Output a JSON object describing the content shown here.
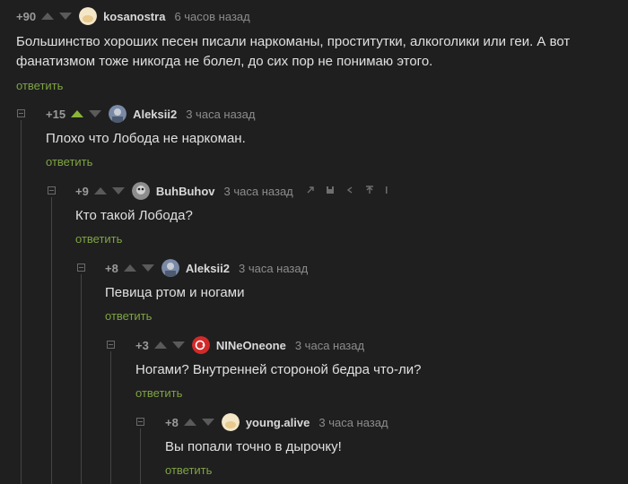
{
  "comments": [
    {
      "rating": "+90",
      "author": "kosanostra",
      "time": "6 часов назад",
      "text": "Большинство хороших песен писали наркоманы, проститутки, алкоголики или геи.  А вот фанатизмом тоже никогда не болел, до сих пор не понимаю этого.",
      "reply": "ответить",
      "avatar_color": "#f3e7c8"
    },
    {
      "rating": "+15",
      "author": "Aleksii2",
      "time": "3 часа назад",
      "text": "Плохо что Лобода не наркоман.",
      "reply": "ответить",
      "avatar_color": "#7a8aa6"
    },
    {
      "rating": "+9",
      "author": "BuhBuhov",
      "time": "3 часа назад",
      "text": "Кто такой Лобода?",
      "reply": "ответить",
      "avatar_color": "#8d8d8d"
    },
    {
      "rating": "+8",
      "author": "Aleksii2",
      "time": "3 часа назад",
      "text": "Певица ртом и ногами",
      "reply": "ответить",
      "avatar_color": "#7a8aa6"
    },
    {
      "rating": "+3",
      "author": "NINeOneone",
      "time": "3 часа назад",
      "text": "Ногами? Внутренней стороной бедра что-ли?",
      "reply": "ответить",
      "avatar_color": "#d22a2a"
    },
    {
      "rating": "+8",
      "author": "young.alive",
      "time": "3 часа назад",
      "text": "Вы попали точно в дырочку!",
      "reply": "ответить",
      "avatar_color": "#f3e7c8"
    }
  ],
  "icons": [
    "link-icon",
    "save-icon",
    "share-icon",
    "upload-icon",
    "more-icon"
  ],
  "colors": {
    "background": "#1f1f1f",
    "reply": "#7ea442",
    "upvote_active": "#8ab53a"
  }
}
